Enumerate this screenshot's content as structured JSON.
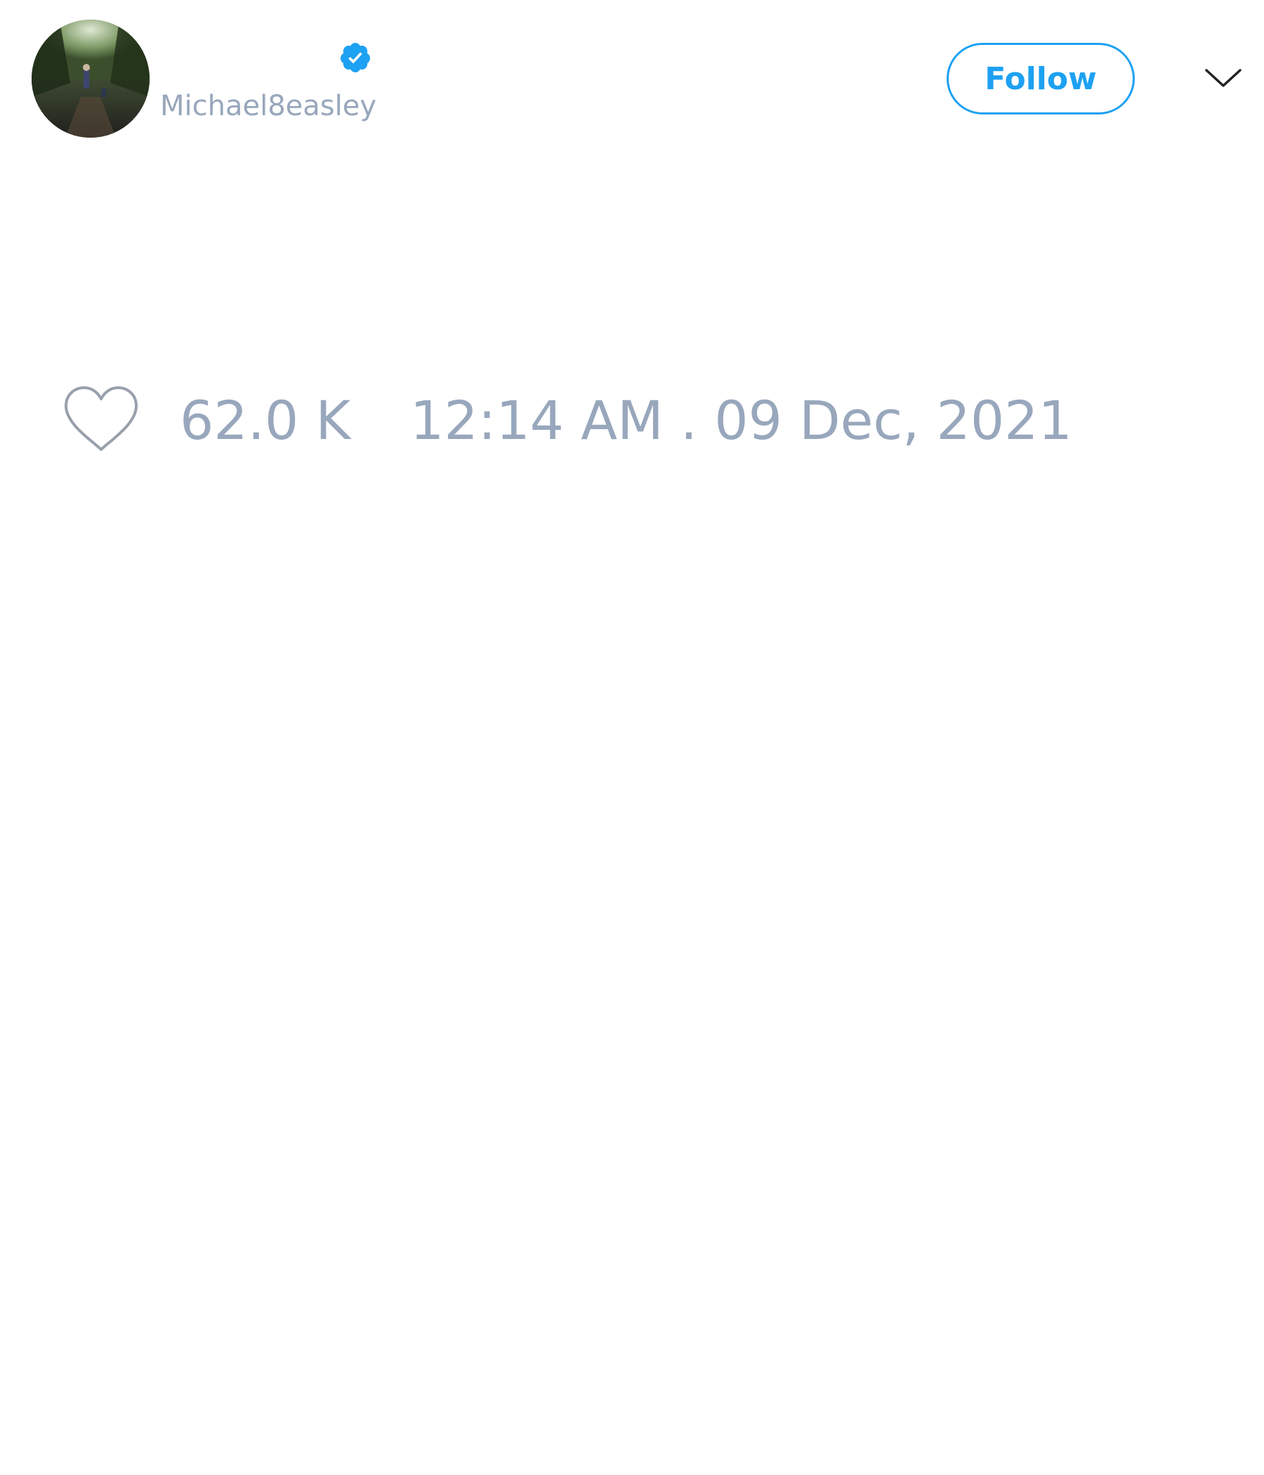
{
  "colors": {
    "accent": "#1da1f2",
    "muted_text": "#98a7bc",
    "heart_outline": "#98a0ab",
    "chevron": "#222222",
    "background": "#ffffff"
  },
  "tweet": {
    "author": {
      "handle": "Michael8easley",
      "verified": true,
      "verified_icon": "verified-badge-icon",
      "avatar_icon": "avatar"
    },
    "follow_label": "Follow",
    "menu_icon": "chevron-down-icon",
    "like_icon": "heart-icon",
    "like_count": "62.0 K",
    "timestamp": "12:14 AM . 09 Dec, 2021"
  }
}
